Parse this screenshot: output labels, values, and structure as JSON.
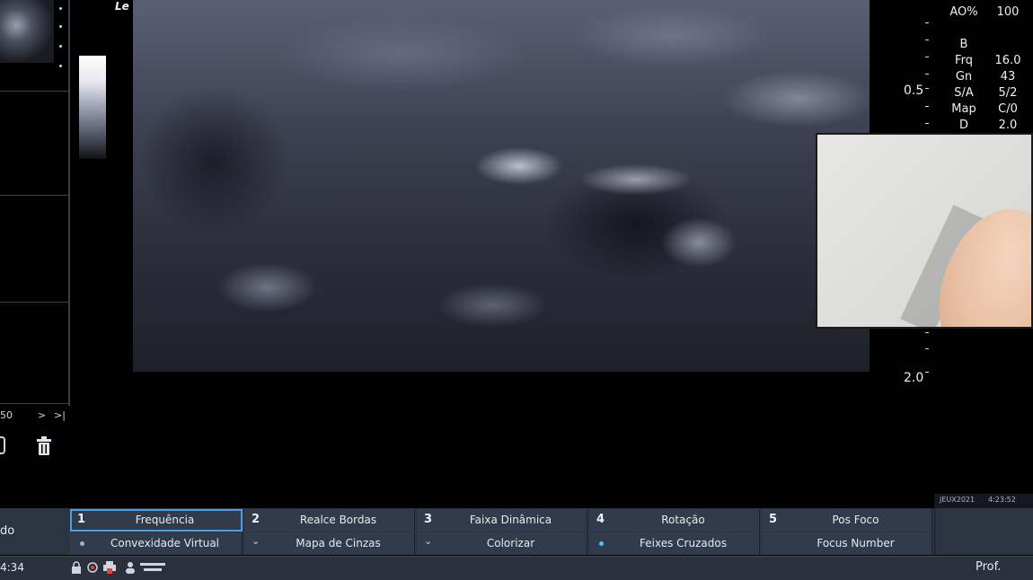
{
  "image": {
    "label": "Le"
  },
  "thumbnails": {
    "nav": {
      "count": "50",
      "next": ">",
      "last": ">|"
    }
  },
  "depth_scale": {
    "top": "0.5",
    "bottom": "2.0"
  },
  "params": [
    {
      "key": "AO%",
      "value": "100"
    },
    {
      "key": "B",
      "value": ""
    },
    {
      "key": "Frq",
      "value": "16.0"
    },
    {
      "key": "Gn",
      "value": "43"
    },
    {
      "key": "S/A",
      "value": "5/2"
    },
    {
      "key": "Map",
      "value": "C/0"
    },
    {
      "key": "D",
      "value": "2.0"
    }
  ],
  "status_strip": {
    "left": "JEUX2021",
    "right": "4:23:52"
  },
  "left_mode": {
    "label": "do"
  },
  "controls": {
    "top": [
      {
        "num": "1",
        "label": "Frequência",
        "selected": true
      },
      {
        "num": "2",
        "label": "Realce Bordas",
        "selected": false
      },
      {
        "num": "3",
        "label": "Faixa Dinâmica",
        "selected": false
      },
      {
        "num": "4",
        "label": "Rotação",
        "selected": false
      },
      {
        "num": "5",
        "label": "Pos Foco",
        "selected": false
      }
    ],
    "bottom": [
      {
        "icon": "dot-icon",
        "label": "Convexidade Virtual",
        "active": false
      },
      {
        "icon": "chevron-down-icon",
        "label": "Mapa de Cinzas"
      },
      {
        "icon": "chevron-down-icon",
        "label": "Colorizar"
      },
      {
        "icon": "dot-icon",
        "label": "Feixes Cruzados",
        "active": true
      },
      {
        "icon": "",
        "label": "Focus Number"
      }
    ]
  },
  "bottom_bar": {
    "clock": "4:34",
    "profile_label": "Prof."
  }
}
